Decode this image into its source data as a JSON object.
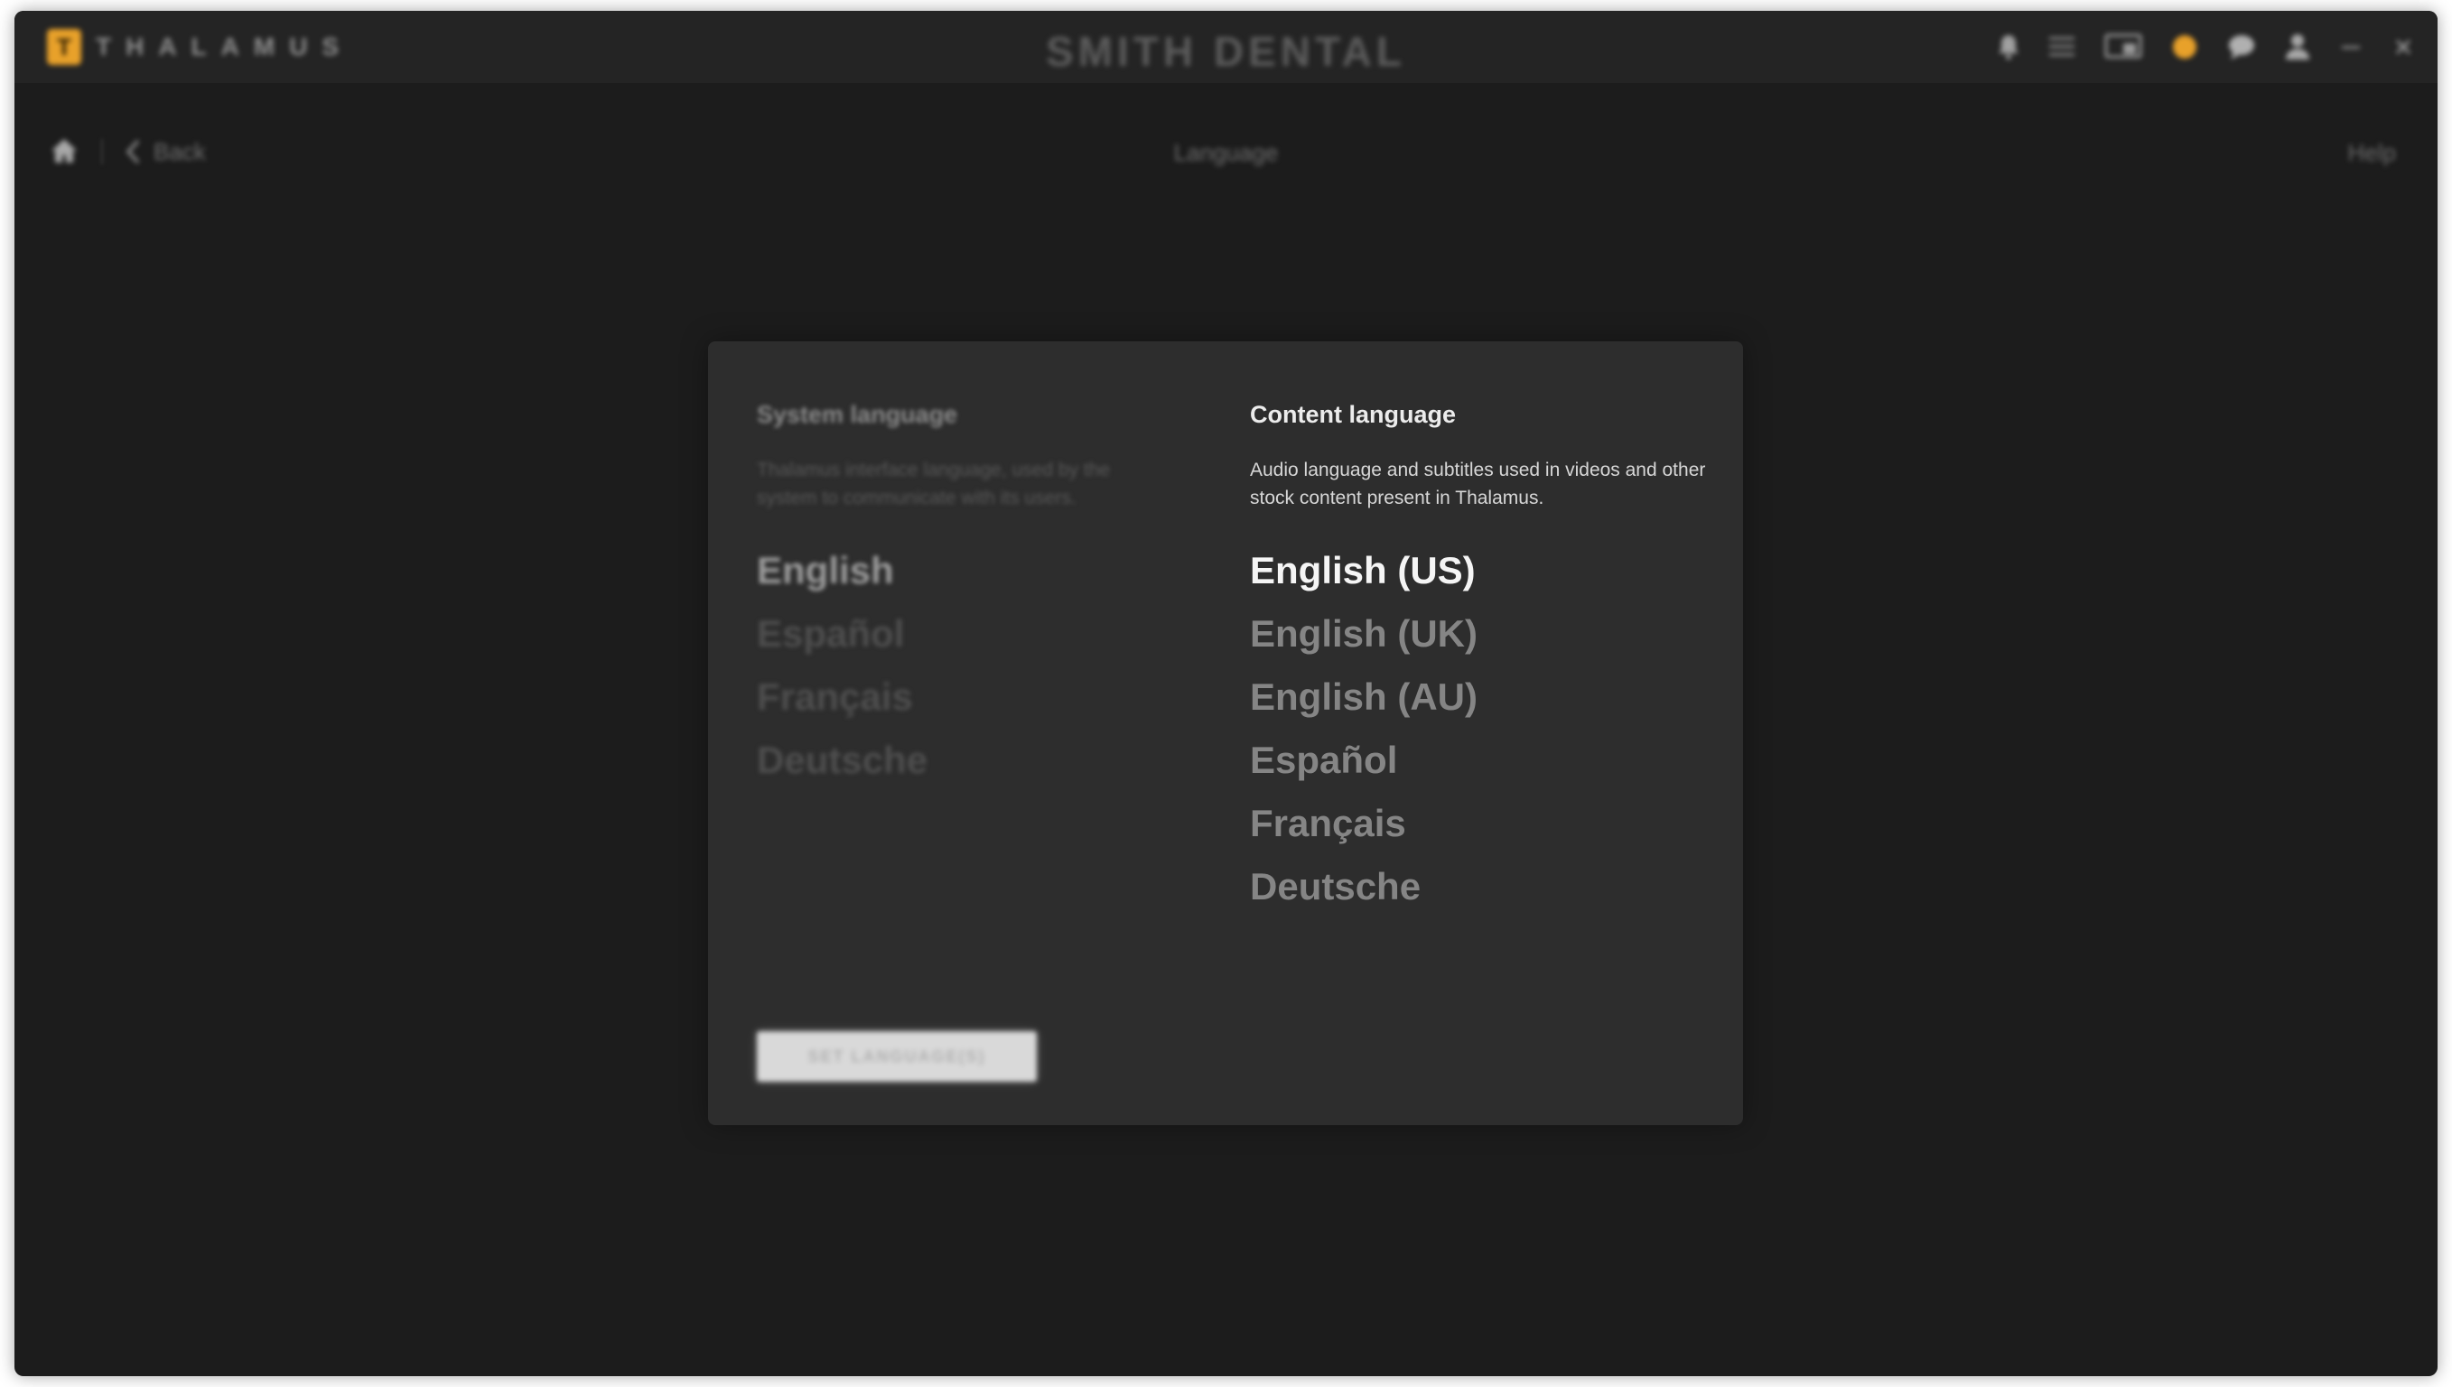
{
  "app": {
    "brand_letter": "T",
    "brand_name": "THALAMUS",
    "practice_name": "SMITH DENTAL"
  },
  "colors": {
    "accent": "#e8a12a",
    "background": "#1c1c1c",
    "panel": "#2d2d2d",
    "selected_text": "#f5f5f5",
    "unselected_text": "#858585"
  },
  "titlebar_icons": [
    "bell-icon",
    "list-icon",
    "screen-icon",
    "coin-icon",
    "chat-icon",
    "user-icon",
    "minimize-icon",
    "close-icon"
  ],
  "nav": {
    "back_label": "Back",
    "page_title": "Language",
    "help_label": "Help"
  },
  "system_language": {
    "heading": "System language",
    "description": "Thalamus interface language, used by the system to communicate with its users.",
    "selected": "English",
    "options": [
      "English",
      "Español",
      "Français",
      "Deutsche"
    ]
  },
  "content_language": {
    "heading": "Content language",
    "description": "Audio language and subtitles used in videos and other stock content present in Thalamus.",
    "selected": "English (US)",
    "options": [
      "English (US)",
      "English (UK)",
      "English (AU)",
      "Español",
      "Français",
      "Deutsche"
    ]
  },
  "actions": {
    "set_button_label": "SET LANGUAGE(S)"
  }
}
